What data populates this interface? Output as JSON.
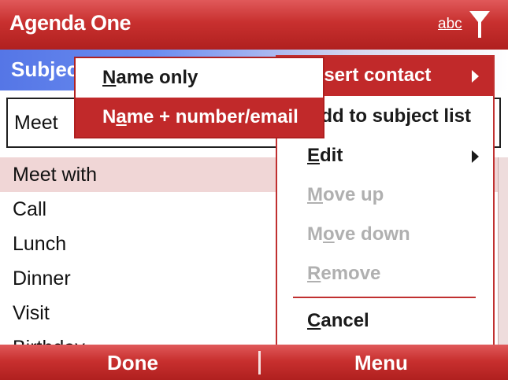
{
  "title_bar": {
    "app_title": "Agenda One",
    "input_mode": "abc",
    "signal_icon": "signal-icon"
  },
  "subject": {
    "label": "Subject:"
  },
  "input": {
    "value": "Meet"
  },
  "list": {
    "items": [
      "Meet with",
      "Call",
      "Lunch",
      "Dinner",
      "Visit",
      "Birthday"
    ],
    "selected_index": 0
  },
  "menu": {
    "insert_contact": {
      "pre": "",
      "acc": "I",
      "post": "nsert contact"
    },
    "add_to_subject": {
      "pre": "",
      "acc": "A",
      "post": "dd to subject list"
    },
    "edit": {
      "pre": "",
      "acc": "E",
      "post": "dit"
    },
    "move_up": {
      "pre": "",
      "acc": "M",
      "post": "ove up"
    },
    "move_down": {
      "pre": "M",
      "acc": "o",
      "post": "ve down"
    },
    "remove": {
      "pre": "",
      "acc": "R",
      "post": "emove"
    },
    "cancel": {
      "pre": "",
      "acc": "C",
      "post": "ancel"
    }
  },
  "submenu": {
    "name_only": {
      "pre": "",
      "acc": "N",
      "post": "ame only"
    },
    "name_number": {
      "pre": "N",
      "acc": "a",
      "post": "me + number/email"
    }
  },
  "softkeys": {
    "left": "Done",
    "right": "Menu"
  },
  "colors": {
    "accent": "#c1292a",
    "subject_bar": "#5576e6",
    "disabled": "#b0b0b0"
  }
}
